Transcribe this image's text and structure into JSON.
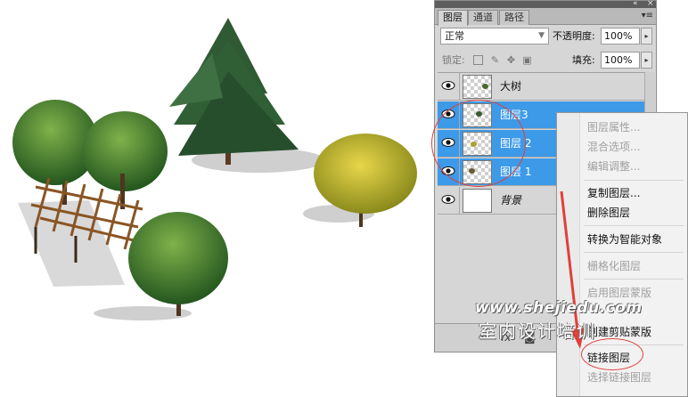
{
  "panel": {
    "tabs": [
      {
        "label": "图层",
        "active": true
      },
      {
        "label": "通道",
        "active": false
      },
      {
        "label": "路径",
        "active": false
      }
    ],
    "blend_mode": "正常",
    "opacity_label": "不透明度:",
    "opacity_value": "100%",
    "lock_label": "锁定:",
    "fill_label": "填充:",
    "fill_value": "100%",
    "layers": [
      {
        "name": "大树",
        "selected": false,
        "visible": true,
        "thumb": "transparent"
      },
      {
        "name": "图层3",
        "selected": true,
        "visible": true,
        "thumb": "transparent"
      },
      {
        "name": "图层 2",
        "selected": true,
        "visible": true,
        "thumb": "transparent"
      },
      {
        "name": "图层 1",
        "selected": true,
        "visible": true,
        "thumb": "transparent"
      },
      {
        "name": "背景",
        "selected": false,
        "visible": true,
        "thumb": "white",
        "italic": true
      }
    ]
  },
  "context_menu": {
    "items": [
      {
        "label": "图层属性...",
        "disabled": true
      },
      {
        "label": "混合选项...",
        "disabled": true
      },
      {
        "label": "编辑调整...",
        "disabled": true
      },
      {
        "separator": true
      },
      {
        "label": "复制图层...",
        "disabled": false
      },
      {
        "label": "删除图层",
        "disabled": false
      },
      {
        "separator": true
      },
      {
        "label": "转换为智能对象",
        "disabled": false
      },
      {
        "separator": true
      },
      {
        "label": "栅格化图层",
        "disabled": true
      },
      {
        "separator": true
      },
      {
        "label": "启用图层蒙版",
        "disabled": true
      },
      {
        "label": "创建剪贴蒙版",
        "disabled": false
      },
      {
        "separator": true
      },
      {
        "label": "链接图层",
        "disabled": false
      },
      {
        "label": "选择链接图层",
        "disabled": true
      }
    ]
  },
  "watermark": {
    "url": "www.shejiedu.com",
    "text": "室内设计培训"
  },
  "colors": {
    "selection": "#3d9ae8",
    "annotation": "#e0403a",
    "panel_bg": "#d6d6d6"
  },
  "icons": [
    "eye-icon",
    "lock-transparent-icon",
    "lock-paint-icon",
    "lock-move-icon",
    "lock-all-icon",
    "link-icon",
    "fx-icon",
    "panel-menu-icon"
  ]
}
